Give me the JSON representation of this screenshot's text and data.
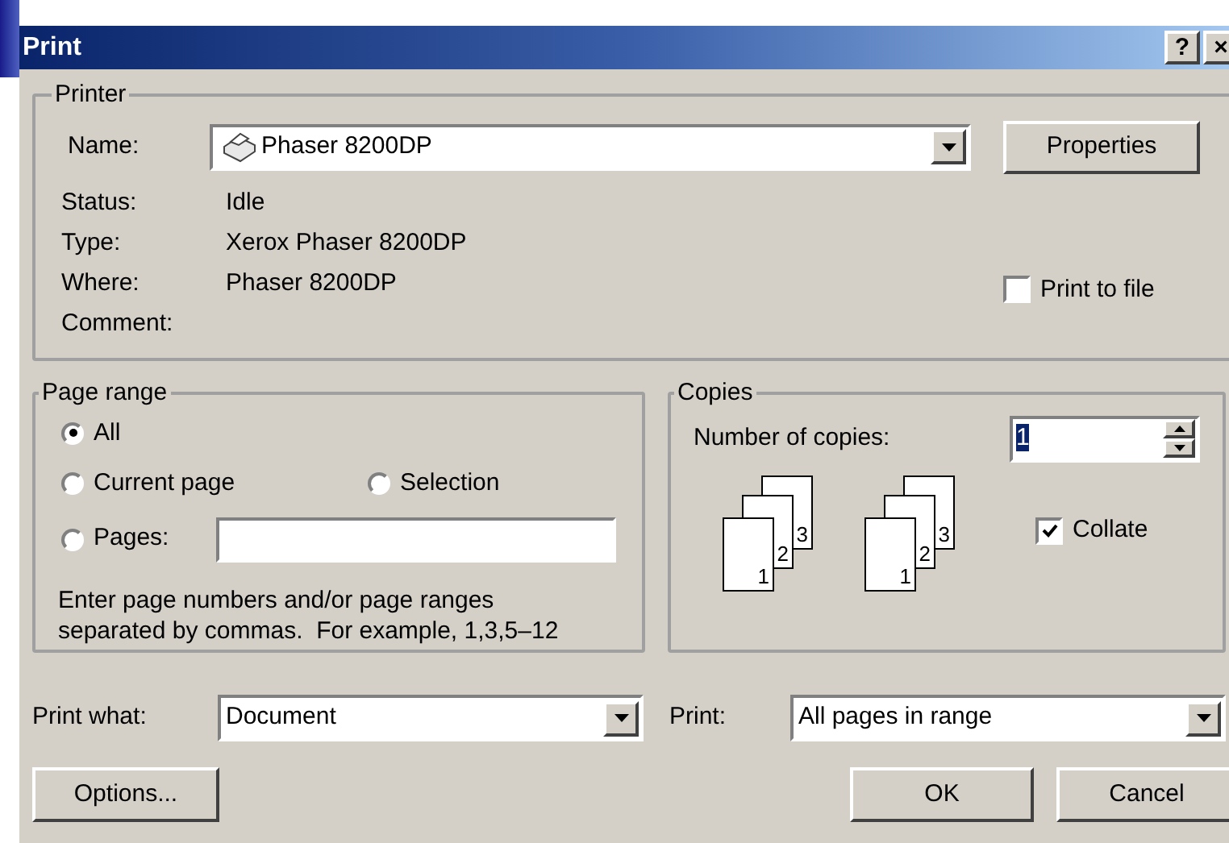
{
  "window": {
    "title": "Print",
    "help_button": "?",
    "close_button": "×"
  },
  "printer": {
    "legend": "Printer",
    "name_label": "Name:",
    "name_value": "Phaser 8200DP",
    "properties_button": "Properties",
    "info": [
      {
        "label": "Status:",
        "value": "Idle"
      },
      {
        "label": "Type:",
        "value": "Xerox Phaser 8200DP"
      },
      {
        "label": "Where:",
        "value": "Phaser 8200DP"
      },
      {
        "label": "Comment:"
      }
    ],
    "print_to_file": {
      "label": "Print to file",
      "checked": false
    }
  },
  "page_range": {
    "legend": "Page range",
    "options": [
      {
        "label": "All",
        "selected": true
      },
      {
        "label": "Current page",
        "selected": false
      },
      {
        "label": "Selection",
        "selected": false
      },
      {
        "label": "Pages:",
        "selected": false
      }
    ],
    "hint": "Enter page numbers and/or page ranges\nseparated by commas.  For example, 1,3,5–12"
  },
  "copies": {
    "legend": "Copies",
    "number_label": "Number of copies:",
    "number_value": "1",
    "page_stacks": [
      [
        "3",
        "2",
        "1"
      ],
      [
        "3",
        "2",
        "1"
      ]
    ],
    "collate": {
      "label": "Collate",
      "checked": true
    }
  },
  "print_what": {
    "label": "Print what:",
    "value": "Document"
  },
  "print": {
    "label": "Print:",
    "value": "All pages in range"
  },
  "buttons": {
    "options": "Options...",
    "ok": "OK",
    "cancel": "Cancel"
  }
}
